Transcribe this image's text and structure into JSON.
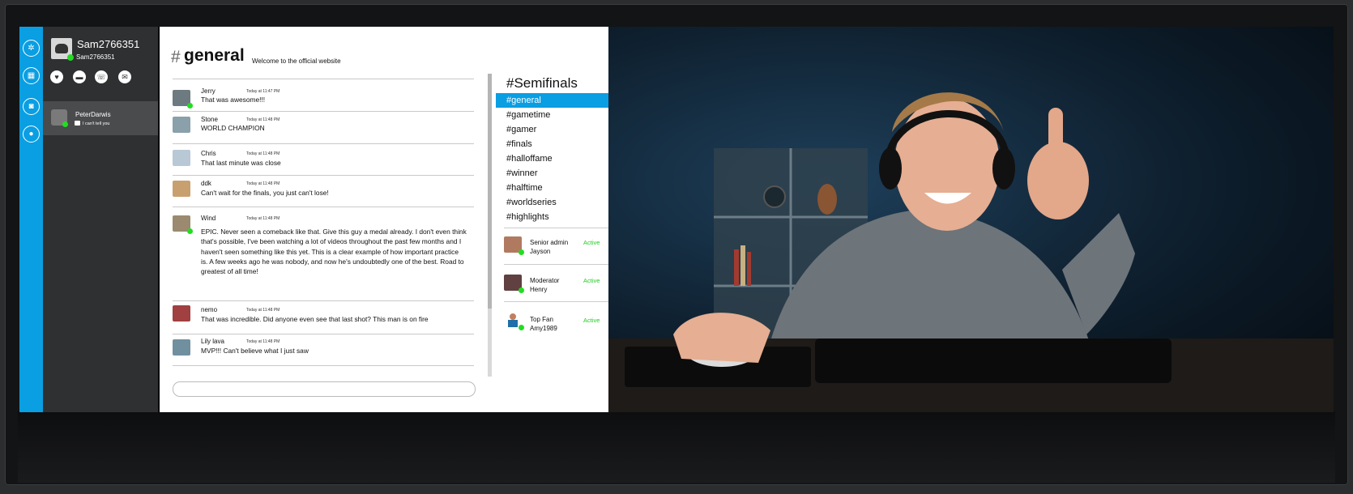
{
  "user": {
    "name": "Sam2766351",
    "handle": "Sam2766351"
  },
  "quick_actions": [
    "heart-icon",
    "message-icon",
    "phone-icon",
    "mail-icon"
  ],
  "rail_icons": [
    "settings-icon",
    "gamepad-icon",
    "camera-icon",
    "user-icon"
  ],
  "dm": {
    "name": "PeterDarwis",
    "preview": "I can't tell you"
  },
  "channel": {
    "hash": "#",
    "name": "general",
    "description": "Welcome to the official website"
  },
  "messages": [
    {
      "name": "Jerry",
      "time": "Today at 11:47 PM",
      "text": "That was awesome!!!"
    },
    {
      "name": "Stone",
      "time": "Today at 11:48 PM",
      "text": "WORLD CHAMPION"
    },
    {
      "name": "Chris",
      "time": "Today at 11:48 PM",
      "text": "That last minute was close"
    },
    {
      "name": "ddk",
      "time": "Today at 11:48 PM",
      "text": "Can't wait for the finals, you just can't lose!"
    },
    {
      "name": "Wind",
      "time": "Today at 11:48 PM",
      "text": "EPIC. Never seen a comeback like that. Give this guy a medal already. I don't even think that's possible, I've been watching a lot of videos throughout the past few months and I haven't seen something like this yet. This is a clear example of how important practice is. A few weeks ago he was nobody, and now he's undoubtedly one of the best. Road to greatest of all time!"
    },
    {
      "name": "nemo",
      "time": "Today at 11:48 PM",
      "text": "That was incredible. Did anyone even see that last shot? This man is on fire"
    },
    {
      "name": "Lily lava",
      "time": "Today at 11:48 PM",
      "text": "MVP!!! Can't believe what I just saw"
    }
  ],
  "channels_header": "#Semifinals",
  "channels": [
    "#general",
    "#gametime",
    "#gamer",
    "#finals",
    "#halloffame",
    "#winner",
    "#halftime",
    "#worldseries",
    "#highlights"
  ],
  "active_channel": "#general",
  "staff": [
    {
      "role": "Senior admin",
      "name": "Jayson",
      "status": "Active"
    },
    {
      "role": "Moderator",
      "name": "Henry",
      "status": "Active"
    },
    {
      "role": "Top Fan",
      "name": "Amy1989",
      "status": "Active"
    }
  ],
  "colors": {
    "accent": "#0a9ee2",
    "online": "#22dd22",
    "sidebar": "#2f3032"
  }
}
